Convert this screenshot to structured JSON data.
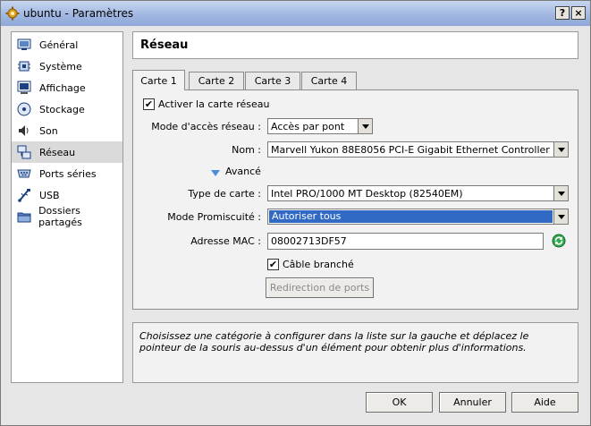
{
  "window": {
    "title": "ubuntu - Paramètres",
    "help_label": "?",
    "close_label": "×"
  },
  "sidebar": {
    "items": [
      {
        "label": "Général",
        "icon": "monitor-icon"
      },
      {
        "label": "Système",
        "icon": "chip-icon"
      },
      {
        "label": "Affichage",
        "icon": "display-icon"
      },
      {
        "label": "Stockage",
        "icon": "disk-icon"
      },
      {
        "label": "Son",
        "icon": "speaker-icon"
      },
      {
        "label": "Réseau",
        "icon": "network-icon"
      },
      {
        "label": "Ports séries",
        "icon": "serial-port-icon"
      },
      {
        "label": "USB",
        "icon": "usb-icon"
      },
      {
        "label": "Dossiers partagés",
        "icon": "folder-icon"
      }
    ],
    "selected_index": 5
  },
  "header": {
    "title": "Réseau"
  },
  "tabs": [
    {
      "label": "Carte 1"
    },
    {
      "label": "Carte 2"
    },
    {
      "label": "Carte 3"
    },
    {
      "label": "Carte 4"
    }
  ],
  "form": {
    "enable_label": "Activer la carte réseau",
    "enable_checked": true,
    "access_mode_label": "Mode d'accès réseau :",
    "access_mode_value": "Accès par pont",
    "name_label": "Nom :",
    "name_value": "Marvell Yukon 88E8056 PCI-E Gigabit Ethernet Controller",
    "advanced_label": "Avancé",
    "card_type_label": "Type de carte :",
    "card_type_value": "Intel PRO/1000 MT Desktop (82540EM)",
    "promisc_label": "Mode Promiscuité :",
    "promisc_value": "Autoriser tous",
    "mac_label": "Adresse MAC :",
    "mac_value": "08002713DF57",
    "cable_label": "Câble branché",
    "cable_checked": true,
    "port_forward_label": "Redirection de ports"
  },
  "info": {
    "text": "Choisissez une catégorie à configurer dans la liste sur la gauche et déplacez le pointeur de la souris au-dessus d'un élément pour obtenir plus d'informations."
  },
  "buttons": {
    "ok": "OK",
    "cancel": "Annuler",
    "help": "Aide"
  },
  "colors": {
    "selection": "#316ac5",
    "titlebar": "#9fb6e0"
  }
}
